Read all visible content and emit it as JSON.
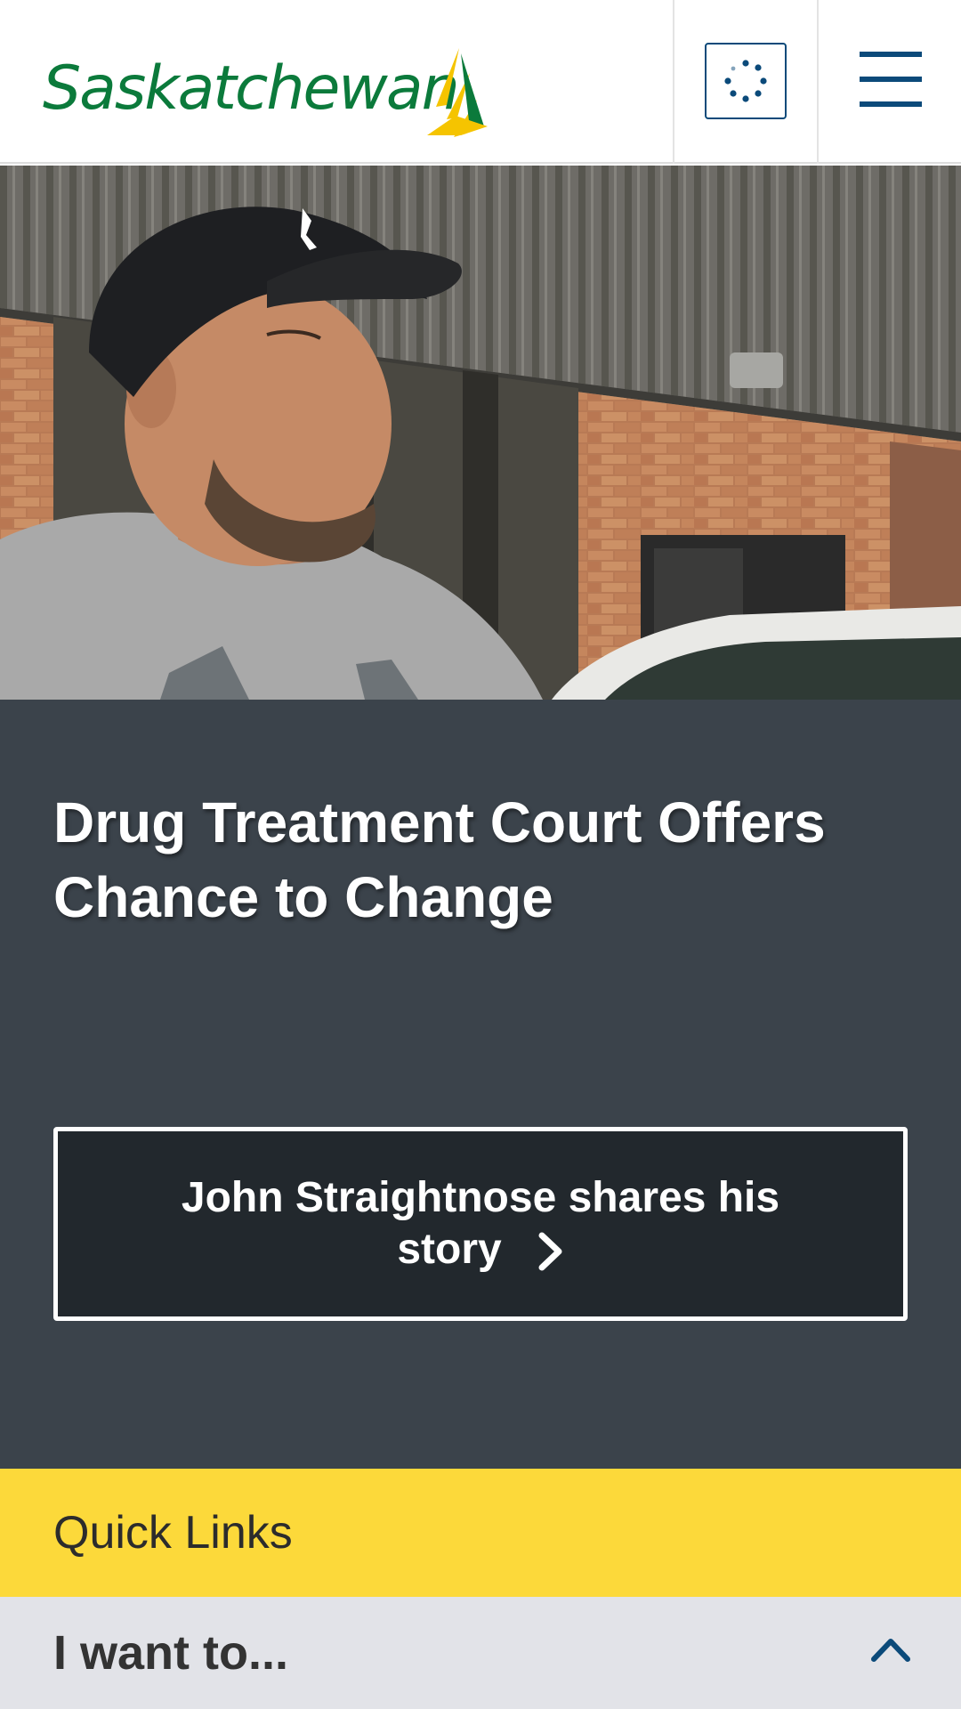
{
  "header": {
    "logo_text": "Saskatchewan",
    "loader_icon": "loading-spinner-icon",
    "menu_icon": "hamburger-menu-icon"
  },
  "hero": {
    "image": "photo-man-in-black-cap-outside-brick-building"
  },
  "feature": {
    "title": "Drug Treatment Court Offers Chance to Change",
    "story_button_label": "John Straightnose shares his story",
    "story_button_icon": "chevron-right-icon"
  },
  "quick_links": {
    "title": "Quick Links"
  },
  "i_want_to": {
    "label": "I want to...",
    "icon": "chevron-up-icon"
  },
  "colors": {
    "brand_green": "#0b7a3b",
    "brand_gold": "#f5c400",
    "nav_blue": "#0b4a7a",
    "panel_dark": "#3b434b",
    "button_dark": "#22282d",
    "quick_links_yellow": "#fcd93a",
    "accordion_gray": "#e2e3e8"
  }
}
